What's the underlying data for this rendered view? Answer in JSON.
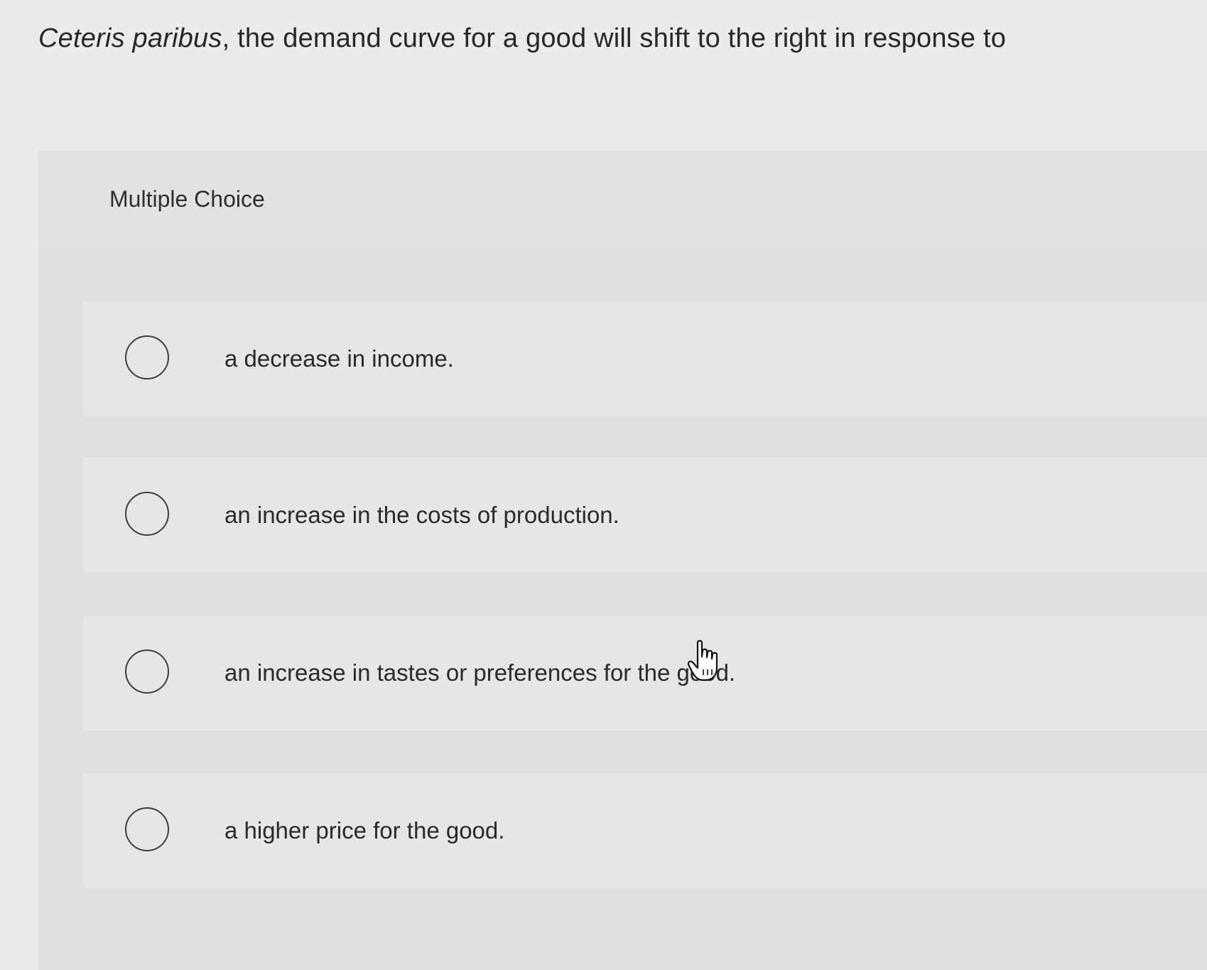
{
  "question": {
    "italic_prefix": "Ceteris paribus",
    "rest": ", the demand curve for a good will shift to the right in response to"
  },
  "panel": {
    "label": "Multiple Choice"
  },
  "options": [
    {
      "label": "a decrease in income."
    },
    {
      "label": "an increase in the costs of production."
    },
    {
      "label": "an increase in tastes or preferences for the good."
    },
    {
      "label": "a higher price for the good."
    }
  ],
  "cursor": {
    "icon": "hand-pointer-icon"
  }
}
